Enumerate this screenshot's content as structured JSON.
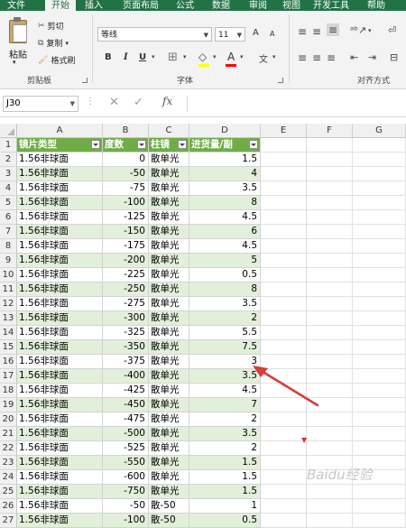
{
  "ribbon_tabs": [
    "文件",
    "开始",
    "插入",
    "页面布局",
    "公式",
    "数据",
    "审阅",
    "视图",
    "开发工具",
    "帮助"
  ],
  "clipboard": {
    "paste_label": "粘贴",
    "cut_label": "剪切",
    "copy_label": "复制",
    "format_painter_label": "格式刷",
    "group_label": "剪贴板"
  },
  "font": {
    "name": "等线",
    "size": "11",
    "grow_label": "A",
    "shrink_label": "A",
    "bold_label": "B",
    "italic_label": "I",
    "underline_label": "U",
    "font_color_label": "A",
    "phonetic_label": "文",
    "group_label": "字体"
  },
  "alignment": {
    "group_label": "对齐方式"
  },
  "formula_bar": {
    "name_box": "J30",
    "fx_label": "fx",
    "formula": ""
  },
  "columns": [
    "A",
    "B",
    "C",
    "D",
    "E",
    "F",
    "G"
  ],
  "table_headers": [
    "镜片类型",
    "度数",
    "柱镜",
    "进货量/副"
  ],
  "rows": [
    {
      "row": "2",
      "type": "1.56非球面",
      "degree": "0",
      "cyl": "散单光",
      "qty": "1.5"
    },
    {
      "row": "3",
      "type": "1.56非球面",
      "degree": "-50",
      "cyl": "散单光",
      "qty": "4"
    },
    {
      "row": "4",
      "type": "1.56非球面",
      "degree": "-75",
      "cyl": "散单光",
      "qty": "3.5"
    },
    {
      "row": "5",
      "type": "1.56非球面",
      "degree": "-100",
      "cyl": "散单光",
      "qty": "8"
    },
    {
      "row": "6",
      "type": "1.56非球面",
      "degree": "-125",
      "cyl": "散单光",
      "qty": "4.5"
    },
    {
      "row": "7",
      "type": "1.56非球面",
      "degree": "-150",
      "cyl": "散单光",
      "qty": "6"
    },
    {
      "row": "8",
      "type": "1.56非球面",
      "degree": "-175",
      "cyl": "散单光",
      "qty": "4.5"
    },
    {
      "row": "9",
      "type": "1.56非球面",
      "degree": "-200",
      "cyl": "散单光",
      "qty": "5"
    },
    {
      "row": "10",
      "type": "1.56非球面",
      "degree": "-225",
      "cyl": "散单光",
      "qty": "0.5"
    },
    {
      "row": "11",
      "type": "1.56非球面",
      "degree": "-250",
      "cyl": "散单光",
      "qty": "8"
    },
    {
      "row": "12",
      "type": "1.56非球面",
      "degree": "-275",
      "cyl": "散单光",
      "qty": "3.5"
    },
    {
      "row": "13",
      "type": "1.56非球面",
      "degree": "-300",
      "cyl": "散单光",
      "qty": "2"
    },
    {
      "row": "14",
      "type": "1.56非球面",
      "degree": "-325",
      "cyl": "散单光",
      "qty": "5.5"
    },
    {
      "row": "15",
      "type": "1.56非球面",
      "degree": "-350",
      "cyl": "散单光",
      "qty": "7.5"
    },
    {
      "row": "16",
      "type": "1.56非球面",
      "degree": "-375",
      "cyl": "散单光",
      "qty": "3"
    },
    {
      "row": "17",
      "type": "1.56非球面",
      "degree": "-400",
      "cyl": "散单光",
      "qty": "3.5"
    },
    {
      "row": "18",
      "type": "1.56非球面",
      "degree": "-425",
      "cyl": "散单光",
      "qty": "4.5"
    },
    {
      "row": "19",
      "type": "1.56非球面",
      "degree": "-450",
      "cyl": "散单光",
      "qty": "7"
    },
    {
      "row": "20",
      "type": "1.56非球面",
      "degree": "-475",
      "cyl": "散单光",
      "qty": "2"
    },
    {
      "row": "21",
      "type": "1.56非球面",
      "degree": "-500",
      "cyl": "散单光",
      "qty": "3.5"
    },
    {
      "row": "22",
      "type": "1.56非球面",
      "degree": "-525",
      "cyl": "散单光",
      "qty": "2"
    },
    {
      "row": "23",
      "type": "1.56非球面",
      "degree": "-550",
      "cyl": "散单光",
      "qty": "1.5"
    },
    {
      "row": "24",
      "type": "1.56非球面",
      "degree": "-600",
      "cyl": "散单光",
      "qty": "1.5"
    },
    {
      "row": "25",
      "type": "1.56非球面",
      "degree": "-750",
      "cyl": "散单光",
      "qty": "1.5"
    },
    {
      "row": "26",
      "type": "1.56非球面",
      "degree": "-50",
      "cyl": "散-50",
      "qty": "1"
    },
    {
      "row": "27",
      "type": "1.56非球面",
      "degree": "-100",
      "cyl": "散-50",
      "qty": "0.5"
    }
  ],
  "colors": {
    "header_green": "#70ad47",
    "band_green": "#e2efda",
    "excel_green": "#217346",
    "annotation_red": "#d93a3a"
  },
  "watermark": "Baidu经验"
}
